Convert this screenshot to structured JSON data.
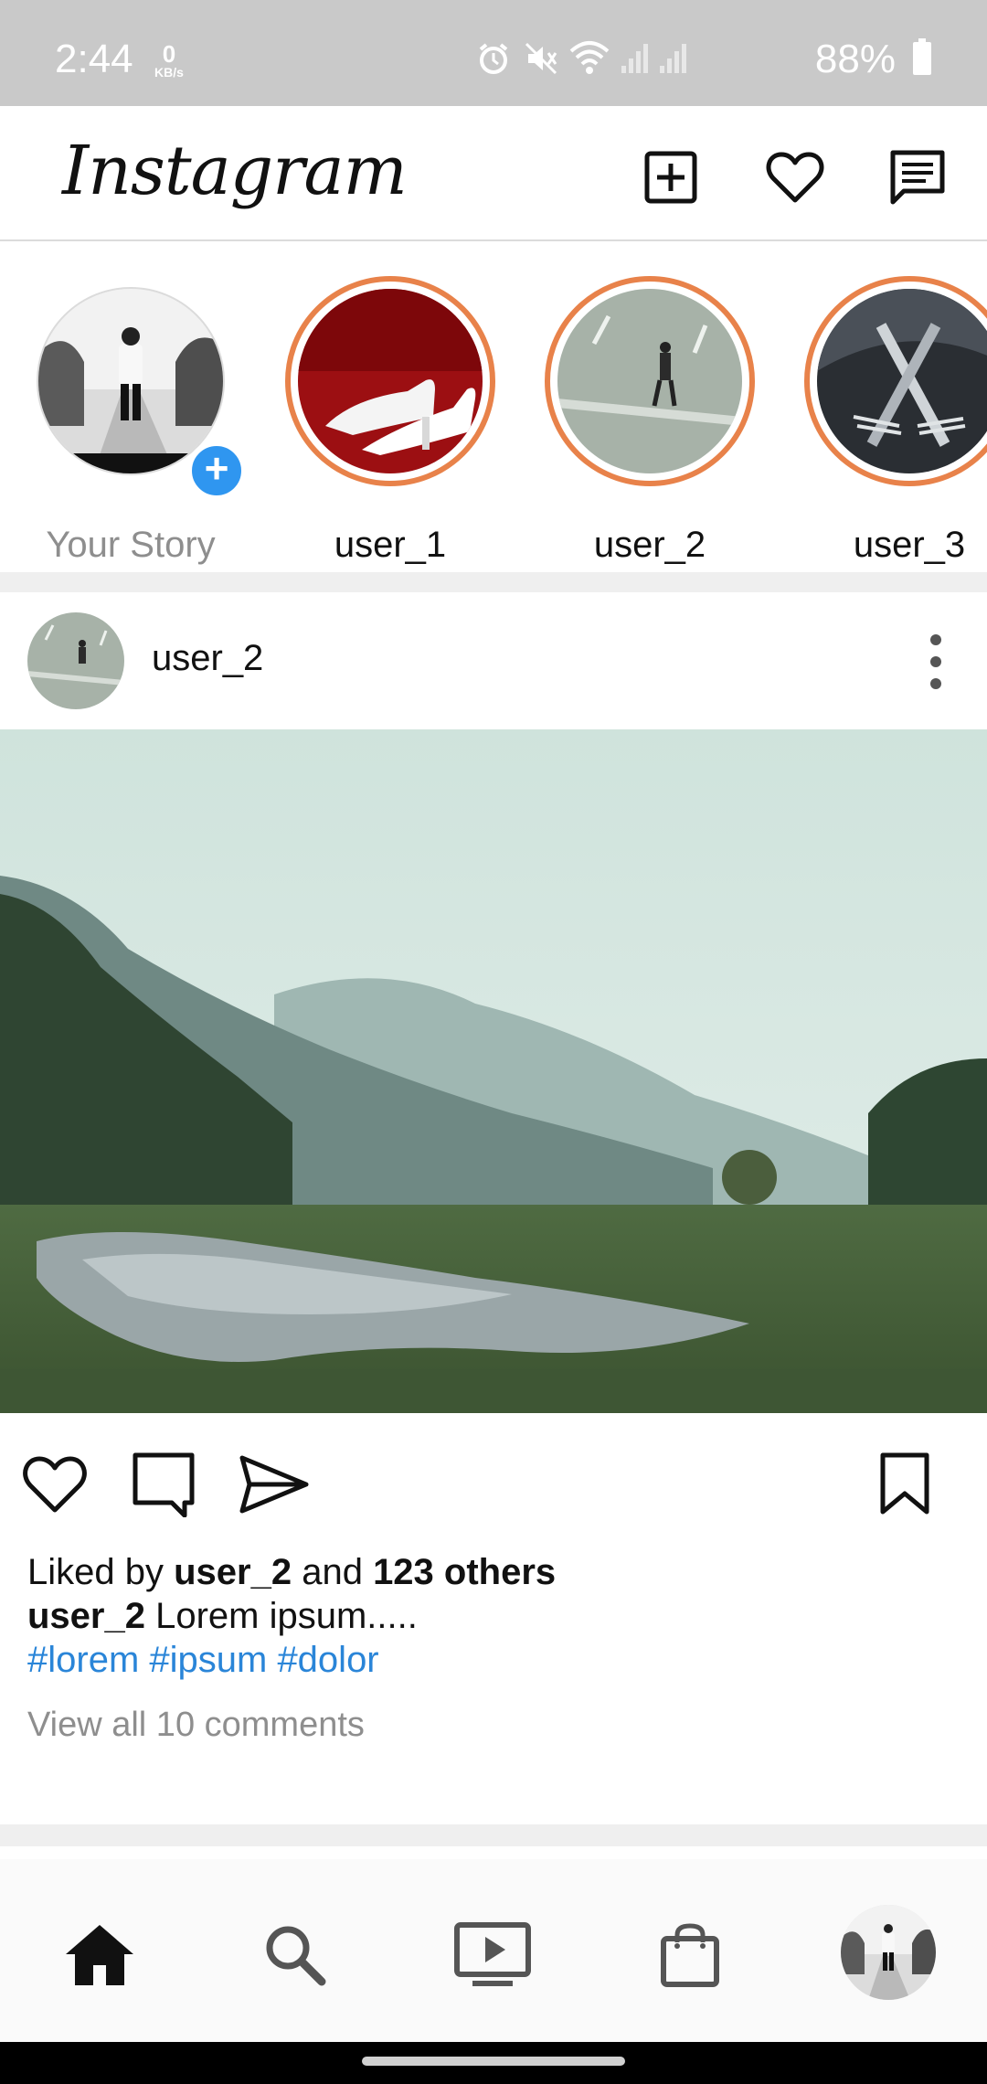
{
  "status_bar": {
    "time": "2:44",
    "net_speed_value": "0",
    "net_speed_unit": "KB/s",
    "battery": "88%"
  },
  "header": {
    "logo": "Instagram",
    "icons": [
      "add-post-icon",
      "heart-icon",
      "messages-icon"
    ]
  },
  "stories": [
    {
      "name": "Your Story",
      "own": true
    },
    {
      "name": "user_1"
    },
    {
      "name": "user_2"
    },
    {
      "name": "user_3"
    }
  ],
  "post": {
    "username": "user_2",
    "liked_prefix": "Liked by ",
    "liked_user": "user_2",
    "liked_mid": " and ",
    "liked_count": "123 others",
    "caption_user": "user_2",
    "caption": " Lorem ipsum.....",
    "hashtags": "#lorem #ipsum #dolor",
    "view_comments": "View all 10 comments"
  },
  "bottom_nav": [
    "home-icon",
    "search-icon",
    "reels-icon",
    "shop-icon",
    "profile-avatar"
  ],
  "colors": {
    "story_ring": "#e8824a",
    "accent_blue": "#2f96f0",
    "hashtag": "#2a85d8",
    "status_bar": "#c9c9c9"
  }
}
